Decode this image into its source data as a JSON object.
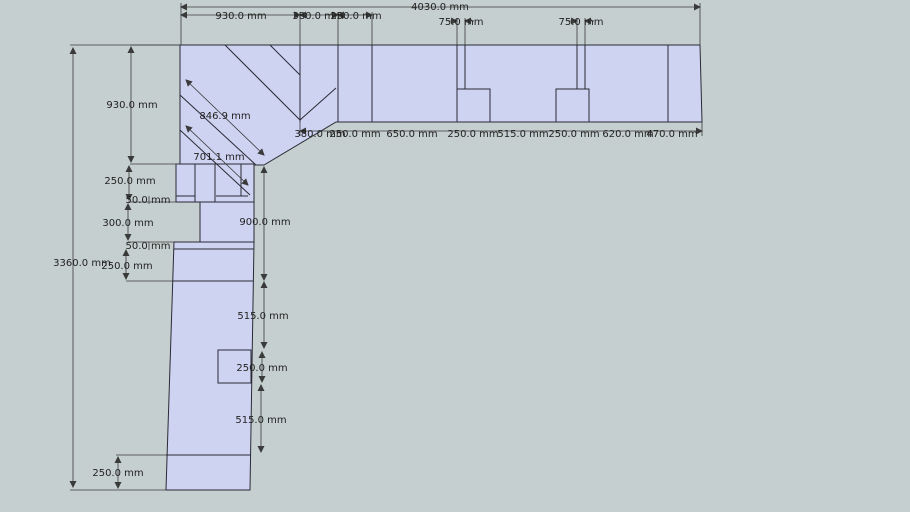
{
  "drawing": {
    "colors": {
      "background": "#c6cfcf",
      "surface": "#cfd3f2",
      "edge": "#2a2a35",
      "dimension": "#3a3a3a"
    },
    "labels": {
      "total_width": "4030.0 mm",
      "top_930": "930.0 mm",
      "top_380": "380.0 mm",
      "top_250": "250.0 mm",
      "top_75_a": "75.0 mm",
      "top_75_b": "75.0 mm",
      "row_380": "380.0 mm",
      "row_250_a": "250.0 mm",
      "row_650": "650.0 mm",
      "row_250_b": "250.0 mm",
      "row_515": "515.0 mm",
      "row_250_c": "250.0 mm",
      "row_620": "620.0 mm",
      "row_470": "470.0 mm",
      "diag_846": "846.9 mm",
      "diag_701": "701.1 mm",
      "left_930": "930.0 mm",
      "left_250_a": "250.0 mm",
      "left_50_a": "50.0 mm",
      "left_300": "300.0 mm",
      "left_50_b": "50.0 mm",
      "left_250_b": "250.0 mm",
      "total_height": "3360.0 mm",
      "right_900": "900.0 mm",
      "right_515_a": "515.0 mm",
      "right_250": "250.0 mm",
      "right_515_b": "515.0 mm",
      "bottom_250": "250.0 mm"
    }
  }
}
